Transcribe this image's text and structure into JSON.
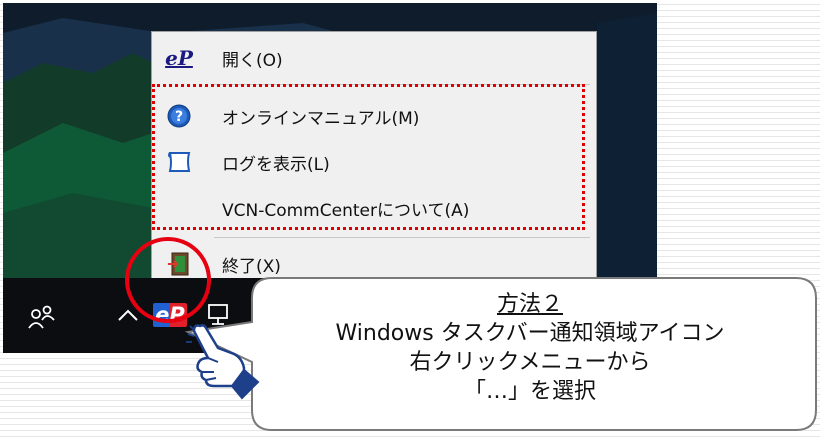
{
  "context_menu": {
    "items": [
      {
        "label": "開く(O)",
        "icon": "ep-logo-icon"
      },
      {
        "label": "オンラインマニュアル(M)",
        "icon": "help-icon"
      },
      {
        "label": "ログを表示(L)",
        "icon": "log-scroll-icon"
      },
      {
        "label": "VCN-CommCenterについて(A)",
        "icon": ""
      },
      {
        "label": "終了(X)",
        "icon": "exit-door-icon"
      }
    ],
    "open_logo_text": "eP"
  },
  "taskbar": {
    "icons": [
      "people-icon",
      "chevron-up-icon",
      "ep-tray-icon",
      "network-icon"
    ],
    "tray_logo_text": "eP"
  },
  "callout": {
    "title": "方法２",
    "lines": [
      "Windows タスクバー通知領域アイコン",
      "右クリックメニューから",
      "「…」を選択"
    ]
  },
  "colors": {
    "highlight": "#e00000",
    "circle": "#e60012",
    "menu_bg": "#f0f0f0",
    "taskbar_bg": "#0b0d10"
  }
}
